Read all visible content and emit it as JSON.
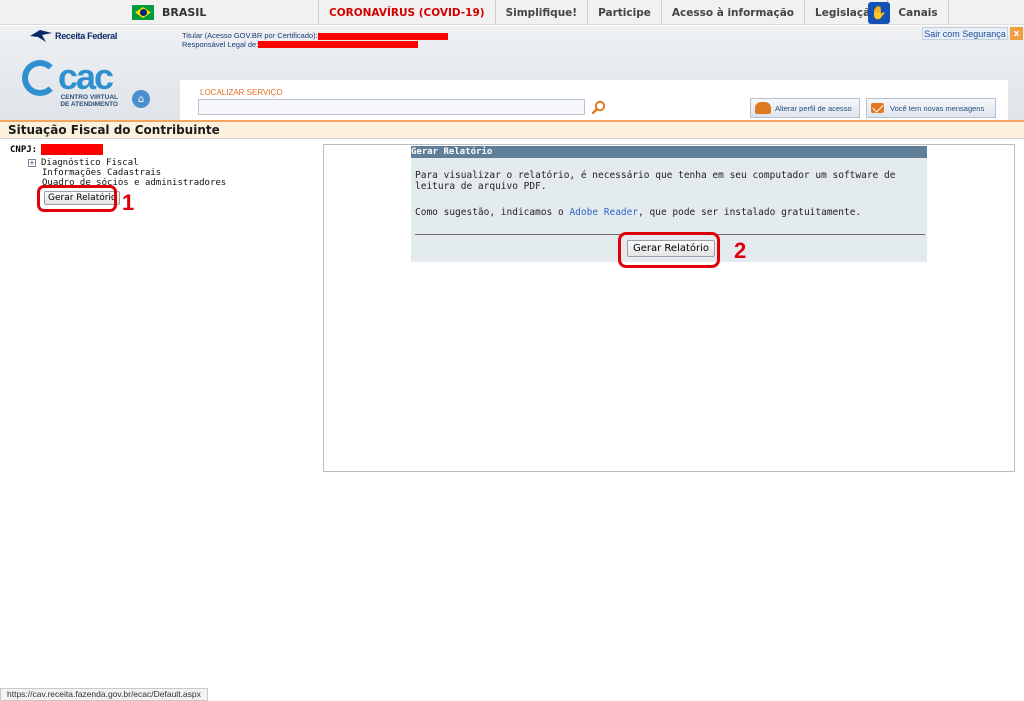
{
  "govbar": {
    "brasil": "BRASIL",
    "links": [
      "CORONAVÍRUS (COVID-19)",
      "Simplifique!",
      "Participe",
      "Acesso à informação",
      "Legislação",
      "Canais"
    ],
    "accent_covid": "#d40000"
  },
  "header": {
    "receita_logo": "Receita Federal",
    "titular_label": "Titular (Acesso GOV.BR por Certificado):",
    "responsavel_label": "Responsável Legal de:",
    "sair": "Sair com Segurança",
    "sair_close": "x",
    "ecac_brand": "cac",
    "ecac_sub": "CENTRO VIRTUAL DE ATENDIMENTO",
    "search_label": "LOCALIZAR SERVIÇO",
    "search_value": "",
    "perfil_button": "Alterar perfil de acesso",
    "mensagens_button": "Você tem novas mensagens"
  },
  "page": {
    "title": "Situação Fiscal do Contribuinte"
  },
  "tree": {
    "cnpj_label": "CNPJ:",
    "items": [
      "Diagnóstico Fiscal",
      "Informações Cadastrais",
      "Quadro de sócios e administradores"
    ],
    "gerar_button": "Gerar Relatório",
    "annotation": "1"
  },
  "report": {
    "header": "Gerar Relatório",
    "p1": "Para visualizar o relatório, é necessário que tenha em seu computador um software de leitura de arquivo PDF.",
    "p2_before": "Como sugestão, indicamos o ",
    "p2_link": "Adobe Reader",
    "p2_after": ", que pode ser instalado gratuitamente.",
    "gerar_button": "Gerar Relatório",
    "annotation": "2"
  },
  "statusbar": {
    "url": "https://cav.receita.fazenda.gov.br/ecac/Default.aspx"
  }
}
